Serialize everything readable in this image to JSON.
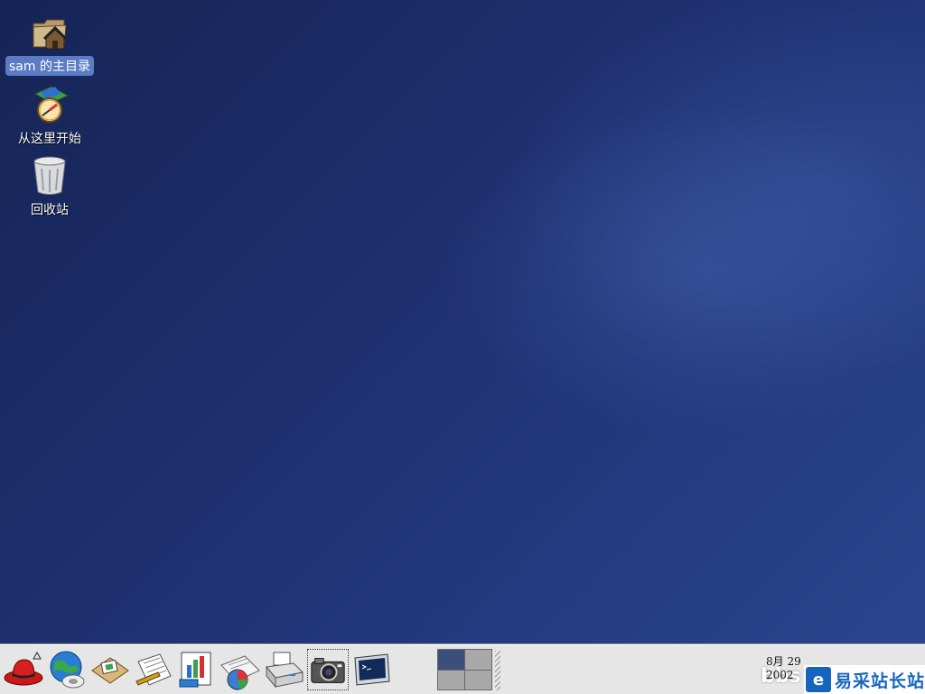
{
  "desktop": {
    "icons": [
      {
        "label": "sam 的主目录",
        "icon": "home-folder-icon",
        "selected": true
      },
      {
        "label": "从这里开始",
        "icon": "start-here-icon",
        "selected": false
      },
      {
        "label": "回收站",
        "icon": "trash-icon",
        "selected": false
      }
    ]
  },
  "panel": {
    "launchers": [
      {
        "icon": "redhat-menu-icon"
      },
      {
        "icon": "web-browser-icon"
      },
      {
        "icon": "email-client-icon"
      },
      {
        "icon": "word-processor-icon"
      },
      {
        "icon": "spreadsheet-icon"
      },
      {
        "icon": "presentation-icon"
      },
      {
        "icon": "print-manager-icon"
      },
      {
        "icon": "screenshot-camera-icon"
      },
      {
        "icon": "terminal-icon"
      }
    ],
    "pager": {
      "workspaces": 4,
      "current": 1
    },
    "clock": {
      "line1": "8月 29",
      "line2": "2002"
    },
    "watermark": {
      "prefix": "bbs",
      "text": "易采站长站"
    }
  },
  "colors": {
    "desktop": "#1d2f6c",
    "panel": "#e6e6e6",
    "selection": "#5b7cc4"
  }
}
